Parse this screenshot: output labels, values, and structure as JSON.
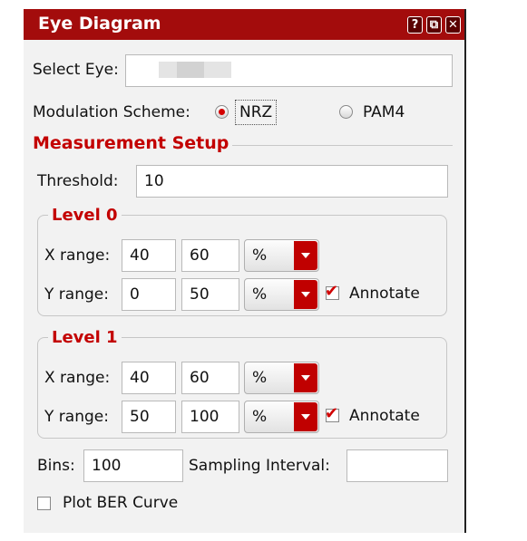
{
  "window": {
    "title": "Eye Diagram",
    "help_glyph": "?",
    "restore_glyph": "⧉",
    "close_glyph": "✕"
  },
  "select_eye": {
    "label": "Select Eye:"
  },
  "modulation": {
    "label": "Modulation Scheme:",
    "options": [
      "NRZ",
      "PAM4"
    ],
    "selected": "NRZ"
  },
  "measurement_setup": {
    "heading": "Measurement Setup"
  },
  "threshold": {
    "label": "Threshold:",
    "value": "10"
  },
  "level0": {
    "title": "Level 0",
    "x_label": "X range:",
    "x_min": "40",
    "x_max": "60",
    "x_unit": "%",
    "y_label": "Y range:",
    "y_min": "0",
    "y_max": "50",
    "y_unit": "%",
    "annotate_label": "Annotate",
    "annotate_checked": true
  },
  "level1": {
    "title": "Level 1",
    "x_label": "X range:",
    "x_min": "40",
    "x_max": "60",
    "x_unit": "%",
    "y_label": "Y range:",
    "y_min": "50",
    "y_max": "100",
    "y_unit": "%",
    "annotate_label": "Annotate",
    "annotate_checked": true
  },
  "bins": {
    "label": "Bins:",
    "value": "100"
  },
  "sampling": {
    "label": "Sampling Interval:",
    "value": ""
  },
  "plot_ber": {
    "label": "Plot BER Curve",
    "checked": false
  },
  "colors": {
    "accent": "#c30000",
    "titlebar": "#a30c0c",
    "panel": "#f2f2f2"
  }
}
